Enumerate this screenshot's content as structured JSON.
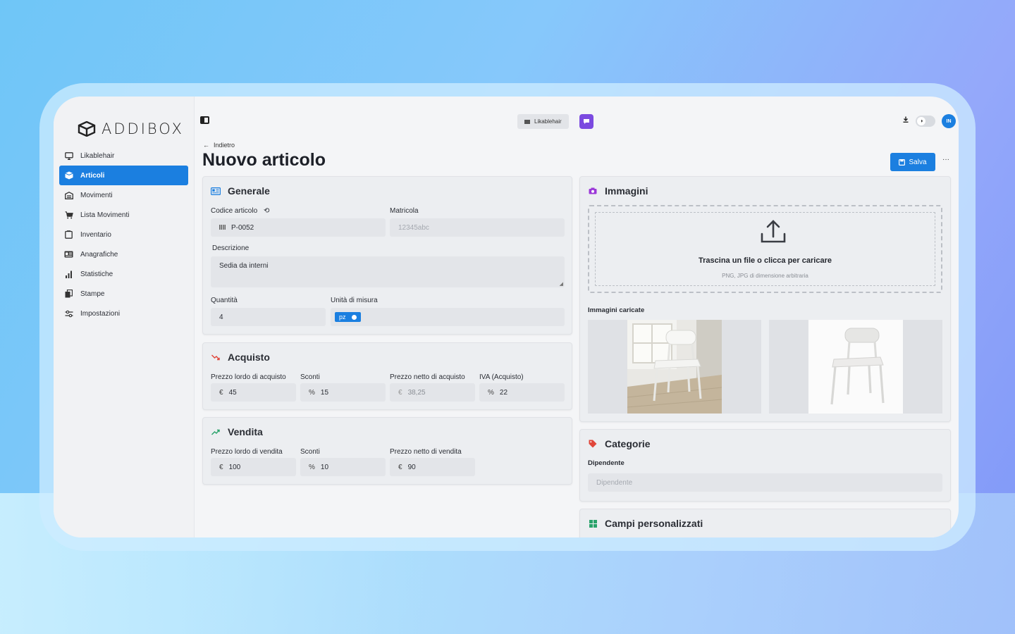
{
  "app": {
    "logo_text": "ADDIBOX"
  },
  "sidebar": {
    "items": [
      {
        "label": "Likablehair",
        "icon": "monitor-icon"
      },
      {
        "label": "Articoli",
        "icon": "box-icon",
        "active": true
      },
      {
        "label": "Movimenti",
        "icon": "warehouse-icon"
      },
      {
        "label": "Lista Movimenti",
        "icon": "cart-icon"
      },
      {
        "label": "Inventario",
        "icon": "clipboard-icon"
      },
      {
        "label": "Anagrafiche",
        "icon": "id-card-icon"
      },
      {
        "label": "Statistiche",
        "icon": "bar-chart-icon"
      },
      {
        "label": "Stampe",
        "icon": "print-icon"
      },
      {
        "label": "Impostazioni",
        "icon": "sliders-icon"
      }
    ]
  },
  "topbar": {
    "tenant": "Likablehair",
    "avatar_initials": "IN"
  },
  "page": {
    "back_label": "Indietro",
    "title": "Nuovo articolo",
    "save_label": "Salva",
    "more_label": "···"
  },
  "generale": {
    "title": "Generale",
    "codice_label": "Codice articolo",
    "codice_value": "P-0052",
    "matricola_label": "Matricola",
    "matricola_placeholder": "12345abc",
    "descrizione_label": "Descrizione",
    "descrizione_value": "Sedia da interni",
    "quantita_label": "Quantità",
    "quantita_value": "4",
    "unita_label": "Unità di misura",
    "unita_value": "pz"
  },
  "acquisto": {
    "title": "Acquisto",
    "lordo_label": "Prezzo lordo di acquisto",
    "lordo_value": "45",
    "sconti_label": "Sconti",
    "sconti_value": "15",
    "netto_label": "Prezzo netto di acquisto",
    "netto_value": "38,25",
    "iva_label": "IVA (Acquisto)",
    "iva_value": "22"
  },
  "vendita": {
    "title": "Vendita",
    "lordo_label": "Prezzo lordo di vendita",
    "lordo_value": "100",
    "sconti_label": "Sconti",
    "sconti_value": "10",
    "netto_label": "Prezzo netto di vendita",
    "netto_value": "90"
  },
  "currency_symbol": "€",
  "percent_symbol": "%",
  "immagini": {
    "title": "Immagini",
    "drop_title": "Trascina un file o clicca per caricare",
    "drop_sub": "PNG, JPG di dimensione arbitraria",
    "uploaded_label": "Immagini caricate"
  },
  "categorie": {
    "title": "Categorie",
    "dipendente_label": "Dipendente",
    "dipendente_placeholder": "Dipendente"
  },
  "campi": {
    "title": "Campi personalizzati"
  },
  "colors": {
    "accent": "#1b7fe0",
    "chat": "#7b4ae0",
    "acquisto_icon": "#e0463a",
    "vendita_icon": "#2aa36b",
    "categorie_icon": "#e0463a",
    "immagini_icon": "#9b38d8",
    "campi_icon": "#2aa36b"
  }
}
